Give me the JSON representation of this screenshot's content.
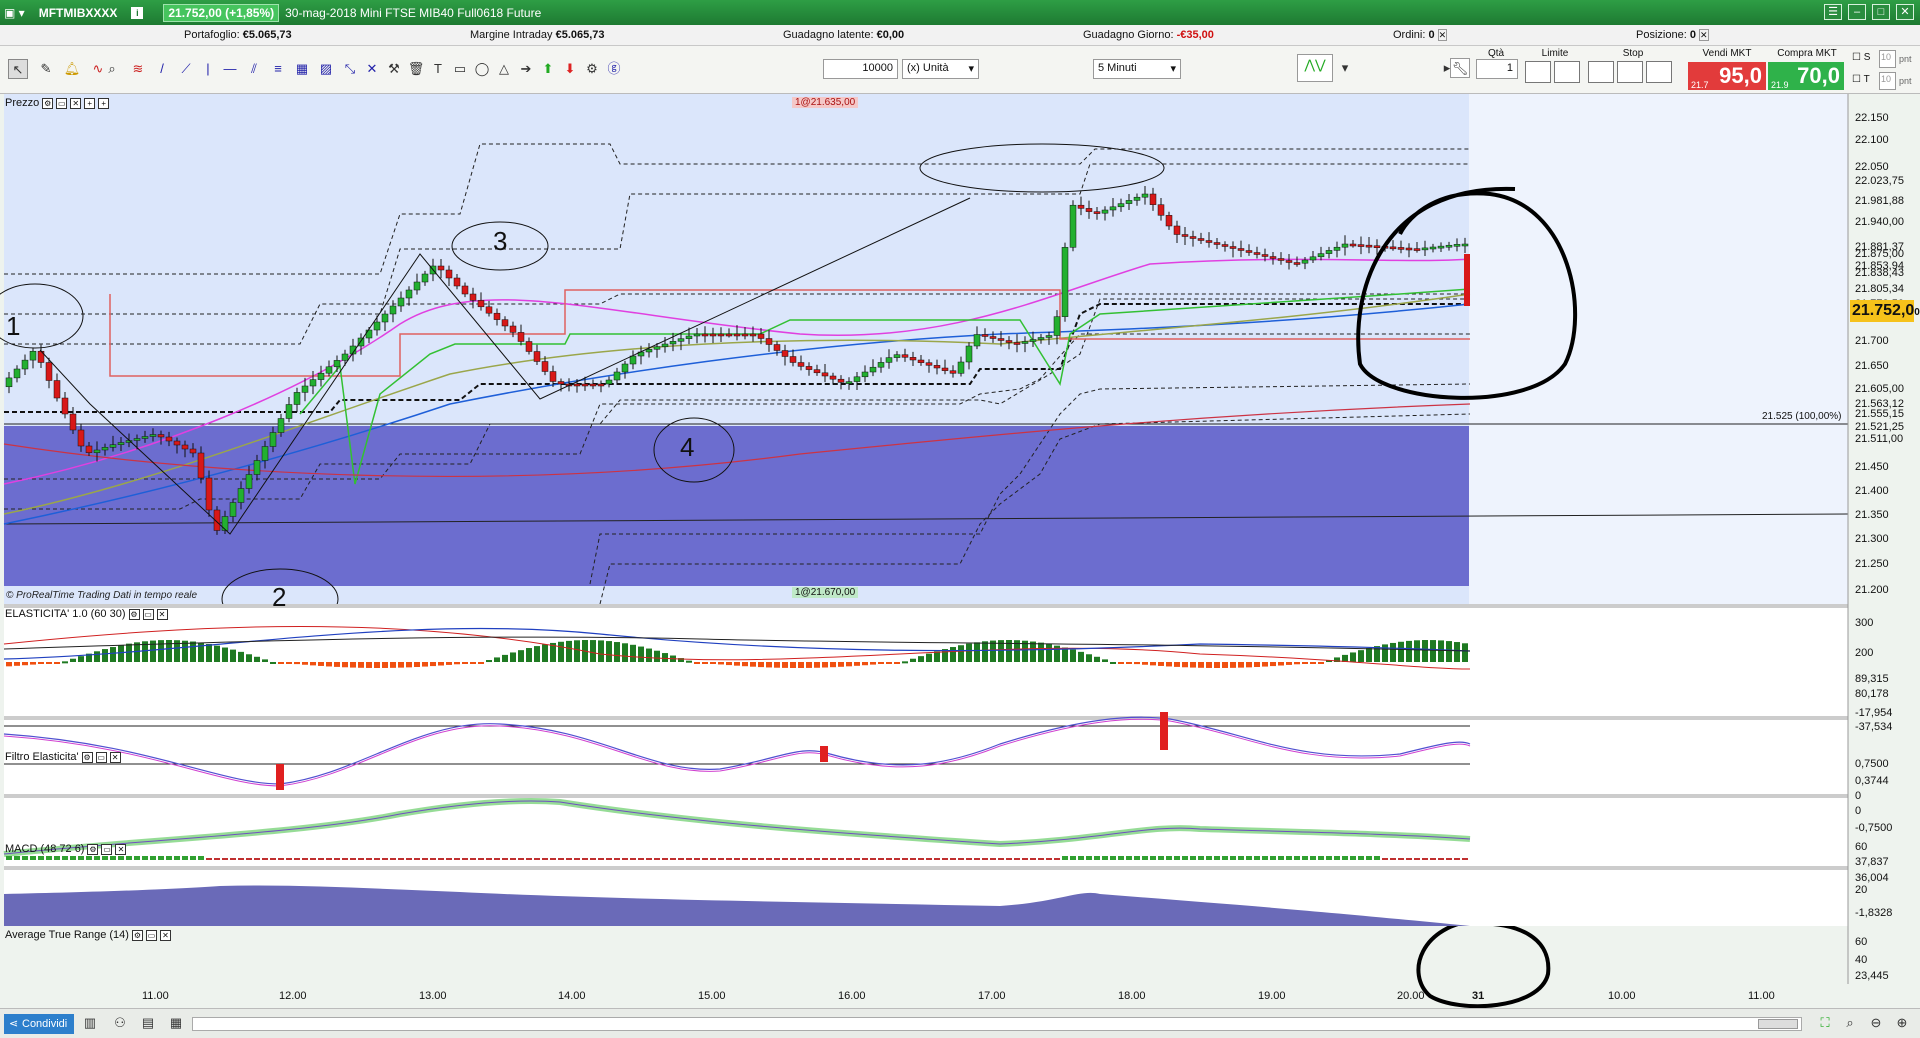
{
  "titlebar": {
    "symbol": "MFTMIBXXXX",
    "price": "21.752,00 (+1,85%)",
    "description": "30-mag-2018  Mini FTSE MIB40 Full0618 Future"
  },
  "infobar": {
    "portafoglio_label": "Portafoglio:",
    "portafoglio_value": "€5.065,73",
    "margine_label": "Margine Intraday",
    "margine_value": "€5.065,73",
    "latente_label": "Guadagno latente:",
    "latente_value": "€0,00",
    "giorno_label": "Guadagno Giorno:",
    "giorno_value": "-€35,00",
    "ordini_label": "Ordini:",
    "ordini_value": "0",
    "posizione_label": "Posizione:",
    "posizione_value": "0"
  },
  "toolbar": {
    "quantity": "10000",
    "unit_select": "(x) Unità",
    "timeframe_select": "5 Minuti",
    "qta_label": "Qtà",
    "qta_value": "1",
    "limite_label": "Limite",
    "stop_label": "Stop",
    "vendi_label": "Vendi MKT",
    "vendi_small": "21.7",
    "vendi_big": "95,0",
    "compra_label": "Compra MKT",
    "compra_small": "21.9",
    "compra_big": "70,0",
    "s_label": "S",
    "t_label": "T",
    "s_value": "10",
    "t_value": "10",
    "pnt_label": "pnt"
  },
  "panels": {
    "price_title": "Prezzo",
    "elasticita_title": "ELASTICITA' 1.0 (60 30)",
    "filtro_title": "Filtro Elasticita'",
    "macd_title": "MACD (48 72 6)",
    "atr_title": "Average True Range (14)"
  },
  "price_axis": [
    "22.150",
    "22.100",
    "22.050",
    "22.023,75",
    "21.981,88",
    "21.940,00",
    "21.881,37",
    "21.875,00",
    "21.853,94",
    "21.838,43",
    "21.805,34",
    "21.772,50",
    "21.700",
    "21.650",
    "21.605,00",
    "21.563,12",
    "21.555,15",
    "21.521,25",
    "21.511,00",
    "21.450",
    "21.400",
    "21.350",
    "21.300",
    "21.250",
    "21.200"
  ],
  "current_price_tag": {
    "big": "21.752,0",
    "small": "0"
  },
  "annotations": {
    "top_order": "1@21.635,00",
    "bottom_order": "1@21.670,00",
    "level_label": "21.525 (100,00%)",
    "wave1": "1",
    "wave2": "2",
    "wave3": "3",
    "wave4": "4",
    "source": "© ProRealTime Trading  Dati in tempo reale"
  },
  "elasticita_axis": [
    "300",
    "200",
    "89,315",
    "80,178",
    "-17,954",
    "-37,534"
  ],
  "filtro_axis": [
    "0,7500",
    "0,3744",
    "0",
    "0",
    "-0,7500"
  ],
  "macd_axis": [
    "60",
    "37,837",
    "36,004",
    "20",
    "-1,8328"
  ],
  "atr_axis": [
    "60",
    "40",
    "23,445"
  ],
  "time_axis": [
    "11.00",
    "12.00",
    "13.00",
    "14.00",
    "15.00",
    "16.00",
    "17.00",
    "18.00",
    "19.00",
    "20.00",
    "31",
    "10.00",
    "11.00"
  ],
  "statusbar": {
    "share_label": "Condividi"
  },
  "colors": {
    "up": "#22b030",
    "down": "#d81818",
    "title_green": "#1e7a32",
    "band_blue": "#5555cc"
  }
}
